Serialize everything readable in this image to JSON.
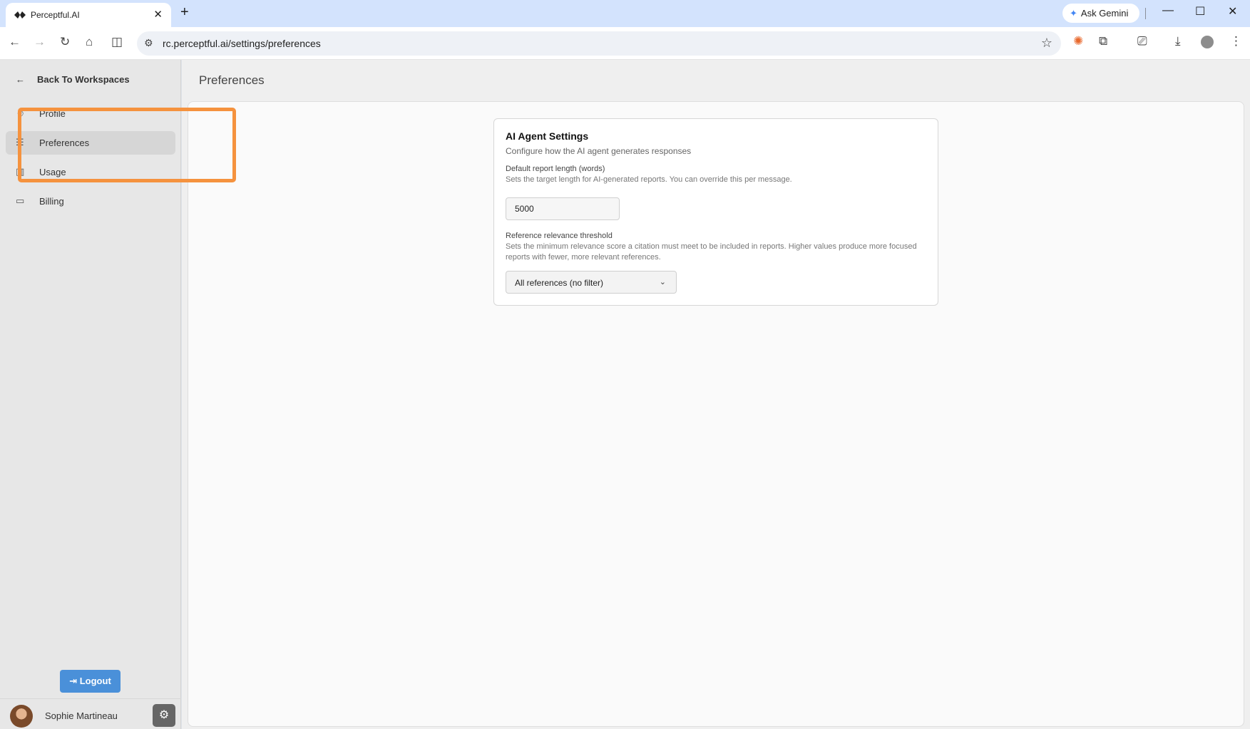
{
  "browser": {
    "tab_title": "Perceptful.AI",
    "new_tab": "+",
    "tab_close": "✕",
    "gemini_label": "Ask Gemini",
    "url": "rc.perceptful.ai/settings/preferences",
    "window": {
      "minimize": "—",
      "maximize": "☐",
      "close": "✕"
    }
  },
  "sidebar": {
    "back_label": "Back To Workspaces",
    "items": [
      {
        "label": "Profile",
        "icon": "user-icon"
      },
      {
        "label": "Preferences",
        "icon": "sliders-icon",
        "active": true
      },
      {
        "label": "Usage",
        "icon": "bar-chart-icon"
      },
      {
        "label": "Billing",
        "icon": "credit-card-icon"
      }
    ],
    "logout_label": "Logout",
    "user_name": "Sophie Martineau"
  },
  "main": {
    "page_title": "Preferences",
    "card": {
      "title": "AI Agent Settings",
      "subtitle": "Configure how the AI agent generates responses",
      "report_length_label": "Default report length (words)",
      "report_length_help": "Sets the target length for AI-generated reports. You can override this per message.",
      "report_length_value": "5000",
      "relevance_label": "Reference relevance threshold",
      "relevance_help": "Sets the minimum relevance score a citation must meet to be included in reports. Higher values produce more focused reports with fewer, more relevant references.",
      "relevance_value": "All references (no filter)"
    }
  },
  "colors": {
    "accent": "#4a90d9",
    "highlight": "#f5923e"
  }
}
